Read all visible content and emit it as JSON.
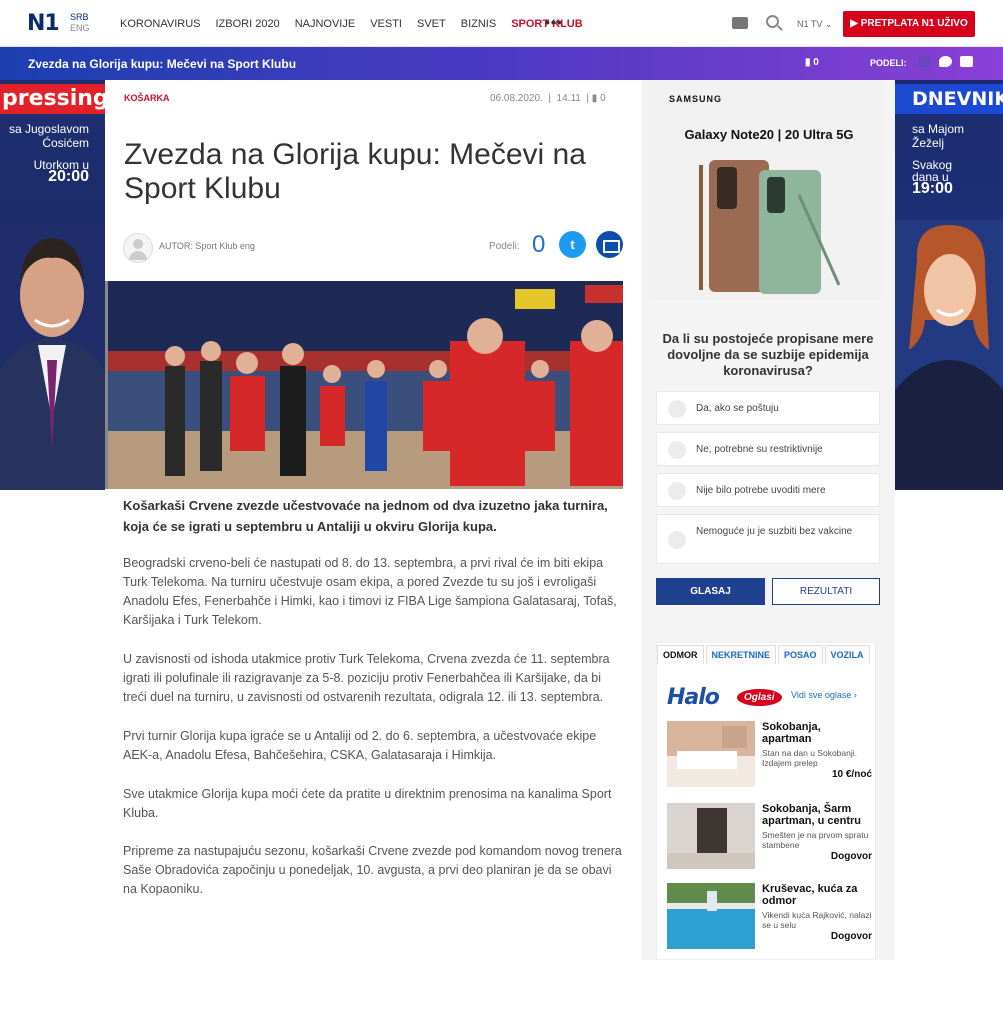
{
  "nav": {
    "logo": "N1",
    "lang_active": "SRB",
    "lang_other": "ENG",
    "items": [
      "KORONAVIRUS",
      "IZBORI 2020",
      "NAJNOVIJE",
      "VESTI",
      "SVET",
      "BIZNIS",
      "SPORT KLUB"
    ],
    "more": "•••",
    "tv": "N1 TV",
    "subscribe": "▶ PRETPLATA N1 UŽIVO"
  },
  "titlebar": {
    "title": "Zvezda na Glorija kupu: Mečevi na Sport Klubu",
    "comments": "0",
    "share": "PODELI:"
  },
  "ad_left": {
    "brand": "pressing",
    "line1": "sa Jugoslavom",
    "line2": "Ćosićem",
    "line3": "Utorkom u",
    "time": "20:00"
  },
  "ad_right": {
    "brand": "DNEVNIK",
    "line1": "sa Majom",
    "line2": "Žeželj",
    "line3": "Svakog",
    "line4": "dana u",
    "time": "19:00"
  },
  "article": {
    "category": "KOŠARKA",
    "date": "06.08.2020.",
    "time": "14.11",
    "comments": "0",
    "headline": "Zvezda na Glorija kupu: Mečevi na Sport Klubu",
    "author": "AUTOR: Sport Klub eng",
    "share_label": "Podeli:",
    "share_count": "0",
    "lead": "Košarkaši Crvene zvezde učestvovaće na jednom od dva izuzetno jaka turnira, koja će se igrati u septembru u Antaliji u okviru Glorija kupa.",
    "paragraphs": [
      "Beogradski crveno-beli će nastupati od 8. do 13. septembra, a prvi rival će im biti ekipa Turk Telekoma. Na turniru učestvuje osam ekipa, a pored Zvezde tu su još i evroligaši Anadolu Efes, Fenerbahče i Himki, kao i timovi iz FIBA Lige šampiona Galatasaraj, Tofaš, Karšijaka i Turk Telekom.",
      "U zavisnosti od ishoda utakmice protiv Turk Telekoma, Crvena zvezda će 11. septembra igrati ili polufinale ili razigravanje za 5-8. poziciju protiv Fenerbahčea ili Karšijake, da bi treći duel na turniru, u zavisnosti od ostvarenih rezultata, odigrala 12. ili 13. septembra.",
      "Prvi turnir Glorija kupa igraće se u Antaliji od 2. do 6. septembra, a učestvovaće ekipe AEK-a, Anadolu Efesa, Bahčešehira, CSKA, Galatasaraja i Himkija.",
      "Sve utakmice Glorija kupa moći ćete da pratite u direktnim prenosima na kanalima Sport Kluba.",
      "Pripreme za nastupajuću sezonu, košarkaši Crvene zvezde pod komandom novog trenera Saše Obradovića započinju u ponedeljak, 10. avgusta, a prvi deo planiran je da se obavi na Kopaoniku."
    ]
  },
  "samsung_ad": {
    "brand": "SAMSUNG",
    "product": "Galaxy Note20 | 20 Ultra 5G"
  },
  "poll": {
    "question": "Da li su postojeće propisane mere dovoljne da se suzbije epidemija koronavirusa?",
    "options": [
      "Da, ako se poštuju",
      "Ne, potrebne su restriktivnije",
      "Nije bilo potrebe uvoditi mere",
      "Nemoguće ju je suzbiti bez vakcine"
    ],
    "vote": "GLASAJ",
    "results": "REZULTATI"
  },
  "classifieds": {
    "tabs": [
      "ODMOR",
      "NEKRETNINE",
      "POSAO",
      "VOZILA"
    ],
    "brand": "Halo",
    "brand_badge": "Oglasi",
    "see_all": "Vidi sve oglase ›",
    "items": [
      {
        "title": "Sokobanja, apartman",
        "desc": "Stan na dan u Sokobanji. Izdajem prelep",
        "price": "10 €/noć"
      },
      {
        "title": "Sokobanja, Šarm apartman, u centru",
        "desc": "Smešten je na prvom spratu stambene",
        "price": "Dogovor"
      },
      {
        "title": "Kruševac, kuća za odmor",
        "desc": "Vikendi kuća Rajković, nalazi se u selu",
        "price": "Dogovor"
      }
    ]
  },
  "colors": {
    "brand_blue": "#0a2a6e",
    "accent_red": "#c8102e",
    "button_blue": "#1f3f8f"
  }
}
